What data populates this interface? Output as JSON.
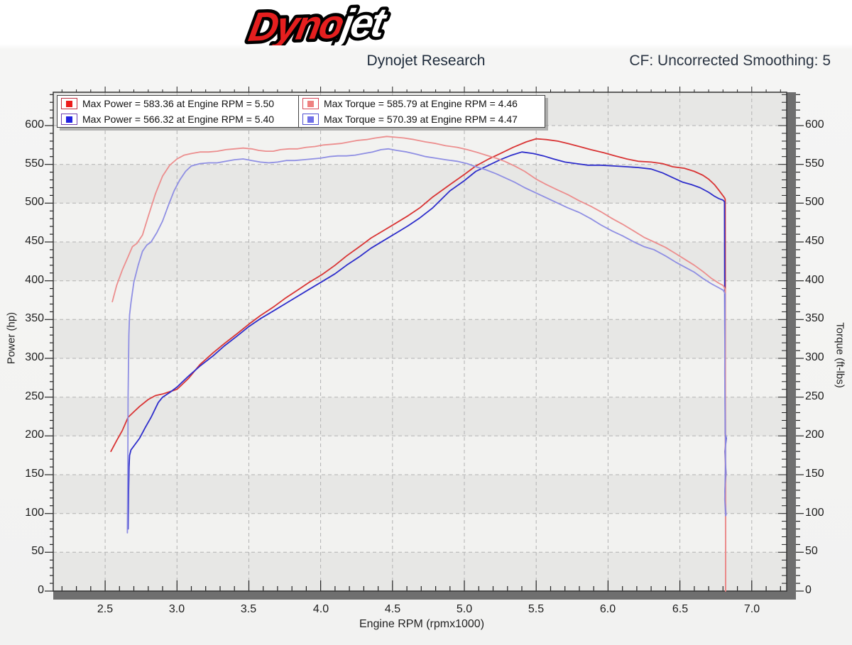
{
  "logo": {
    "dyno": "Dyno",
    "jet": "jet",
    "dyno_color": "#e51f1f",
    "jet_color": "#ffffff"
  },
  "header": {
    "title": "Dynojet Research",
    "cf_label": "CF: Uncorrected Smoothing: 5"
  },
  "legend": [
    {
      "label": "Max Power = 583.36 at Engine RPM = 5.50",
      "swatch": "#ed1c1c",
      "border": "#c03040"
    },
    {
      "label": "Max Power = 566.32 at Engine RPM = 5.40",
      "swatch": "#2222e0",
      "border": "#7040b0"
    },
    {
      "label": "Max Torque = 585.79 at Engine RPM = 4.46",
      "swatch": "#ef8080",
      "border": "#d84858"
    },
    {
      "label": "Max Torque = 570.39 at Engine RPM = 4.47",
      "swatch": "#7070e8",
      "border": "#5050d0"
    }
  ],
  "chart_data": {
    "type": "line",
    "xlabel": "Engine RPM (rpmx1000)",
    "ylabel_left": "Power (hp)",
    "ylabel_right": "Torque (ft-lbs)",
    "xlim": [
      2.139,
      7.243
    ],
    "ylim": [
      0,
      643
    ],
    "x_ticks": [
      "2.5",
      "3.0",
      "3.5",
      "4.0",
      "4.5",
      "5.0",
      "5.5",
      "6.0",
      "6.5",
      "7.0"
    ],
    "x_minor_step": 0.1,
    "y_ticks": [
      0,
      50,
      100,
      150,
      200,
      250,
      300,
      350,
      400,
      450,
      500,
      550,
      600
    ],
    "y_minor_step": 10,
    "grid": "dashed",
    "band_colors": [
      "#e7e7e5",
      "#f2f2f0"
    ],
    "grid_color": "#b2b2b2",
    "max_values": [
      {
        "series": "power-run1",
        "value": 583.36,
        "rpm": 5.5
      },
      {
        "series": "power-run2",
        "value": 566.32,
        "rpm": 5.4
      },
      {
        "series": "torque-run1",
        "value": 585.79,
        "rpm": 4.46
      },
      {
        "series": "torque-run2",
        "value": 570.39,
        "rpm": 4.47
      }
    ],
    "series": [
      {
        "name": "power-run1",
        "color": "#d93434",
        "points": [
          [
            2.54,
            180
          ],
          [
            2.58,
            194
          ],
          [
            2.62,
            207
          ],
          [
            2.66,
            224
          ],
          [
            2.7,
            231
          ],
          [
            2.74,
            238
          ],
          [
            2.8,
            247
          ],
          [
            2.85,
            252
          ],
          [
            2.9,
            254
          ],
          [
            2.95,
            257
          ],
          [
            3.0,
            260
          ],
          [
            3.08,
            274
          ],
          [
            3.16,
            292
          ],
          [
            3.25,
            307
          ],
          [
            3.33,
            319
          ],
          [
            3.42,
            332
          ],
          [
            3.5,
            344
          ],
          [
            3.58,
            355
          ],
          [
            3.67,
            366
          ],
          [
            3.75,
            377
          ],
          [
            3.84,
            388
          ],
          [
            3.92,
            398
          ],
          [
            4.01,
            408
          ],
          [
            4.1,
            420
          ],
          [
            4.18,
            432
          ],
          [
            4.27,
            444
          ],
          [
            4.35,
            455
          ],
          [
            4.44,
            465
          ],
          [
            4.53,
            475
          ],
          [
            4.61,
            484
          ],
          [
            4.69,
            494
          ],
          [
            4.78,
            508
          ],
          [
            4.9,
            524
          ],
          [
            5.0,
            537
          ],
          [
            5.08,
            548
          ],
          [
            5.17,
            557
          ],
          [
            5.25,
            564
          ],
          [
            5.34,
            572
          ],
          [
            5.43,
            579
          ],
          [
            5.5,
            583
          ],
          [
            5.57,
            582
          ],
          [
            5.65,
            580
          ],
          [
            5.72,
            577
          ],
          [
            5.8,
            573
          ],
          [
            5.88,
            569
          ],
          [
            5.97,
            565
          ],
          [
            6.05,
            561
          ],
          [
            6.13,
            557
          ],
          [
            6.21,
            554
          ],
          [
            6.3,
            553
          ],
          [
            6.38,
            551
          ],
          [
            6.45,
            547
          ],
          [
            6.53,
            545
          ],
          [
            6.6,
            541
          ],
          [
            6.66,
            536
          ],
          [
            6.7,
            531
          ],
          [
            6.74,
            524
          ],
          [
            6.77,
            517
          ],
          [
            6.79,
            512
          ],
          [
            6.81,
            507
          ],
          [
            6.815,
            505
          ],
          [
            6.818,
            0
          ]
        ]
      },
      {
        "name": "power-run2",
        "color": "#2d2dcb",
        "points": [
          [
            2.66,
            80
          ],
          [
            2.663,
            130
          ],
          [
            2.666,
            160
          ],
          [
            2.67,
            175
          ],
          [
            2.68,
            182
          ],
          [
            2.7,
            187
          ],
          [
            2.74,
            197
          ],
          [
            2.78,
            211
          ],
          [
            2.82,
            224
          ],
          [
            2.87,
            243
          ],
          [
            2.9,
            250
          ],
          [
            2.95,
            256
          ],
          [
            3.0,
            263
          ],
          [
            3.08,
            277
          ],
          [
            3.16,
            290
          ],
          [
            3.25,
            303
          ],
          [
            3.33,
            316
          ],
          [
            3.42,
            329
          ],
          [
            3.5,
            341
          ],
          [
            3.58,
            351
          ],
          [
            3.67,
            361
          ],
          [
            3.75,
            370
          ],
          [
            3.84,
            380
          ],
          [
            3.92,
            389
          ],
          [
            4.01,
            399
          ],
          [
            4.1,
            409
          ],
          [
            4.18,
            420
          ],
          [
            4.27,
            431
          ],
          [
            4.35,
            442
          ],
          [
            4.44,
            452
          ],
          [
            4.53,
            462
          ],
          [
            4.61,
            471
          ],
          [
            4.69,
            481
          ],
          [
            4.78,
            494
          ],
          [
            4.9,
            516
          ],
          [
            5.0,
            529
          ],
          [
            5.08,
            541
          ],
          [
            5.17,
            549
          ],
          [
            5.25,
            556
          ],
          [
            5.33,
            562
          ],
          [
            5.4,
            566
          ],
          [
            5.48,
            564
          ],
          [
            5.55,
            561
          ],
          [
            5.62,
            557
          ],
          [
            5.7,
            553
          ],
          [
            5.78,
            551
          ],
          [
            5.86,
            549
          ],
          [
            5.95,
            549
          ],
          [
            6.04,
            548
          ],
          [
            6.13,
            547
          ],
          [
            6.21,
            546
          ],
          [
            6.3,
            544
          ],
          [
            6.38,
            539
          ],
          [
            6.45,
            533
          ],
          [
            6.52,
            527
          ],
          [
            6.58,
            524
          ],
          [
            6.64,
            520
          ],
          [
            6.7,
            514
          ],
          [
            6.74,
            509
          ],
          [
            6.77,
            506
          ],
          [
            6.8,
            504
          ],
          [
            6.81,
            502
          ],
          [
            6.812,
            350
          ],
          [
            6.815,
            203
          ],
          [
            6.822,
            197
          ],
          [
            6.814,
            180
          ],
          [
            6.82,
            152
          ],
          [
            6.813,
            128
          ],
          [
            6.82,
            98
          ]
        ]
      },
      {
        "name": "torque-run1",
        "color": "#ec8e8e",
        "points": [
          [
            2.55,
            373
          ],
          [
            2.58,
            394
          ],
          [
            2.62,
            414
          ],
          [
            2.66,
            431
          ],
          [
            2.69,
            444
          ],
          [
            2.72,
            448
          ],
          [
            2.76,
            459
          ],
          [
            2.8,
            483
          ],
          [
            2.85,
            512
          ],
          [
            2.9,
            535
          ],
          [
            2.95,
            549
          ],
          [
            3.0,
            557
          ],
          [
            3.05,
            562
          ],
          [
            3.1,
            564
          ],
          [
            3.16,
            566
          ],
          [
            3.22,
            566
          ],
          [
            3.28,
            567
          ],
          [
            3.34,
            569
          ],
          [
            3.4,
            570
          ],
          [
            3.46,
            571
          ],
          [
            3.52,
            570
          ],
          [
            3.57,
            568
          ],
          [
            3.62,
            567
          ],
          [
            3.67,
            567
          ],
          [
            3.72,
            569
          ],
          [
            3.78,
            570
          ],
          [
            3.84,
            570
          ],
          [
            3.9,
            572
          ],
          [
            3.96,
            573
          ],
          [
            4.02,
            575
          ],
          [
            4.08,
            576
          ],
          [
            4.14,
            577
          ],
          [
            4.2,
            579
          ],
          [
            4.26,
            581
          ],
          [
            4.32,
            582
          ],
          [
            4.38,
            584
          ],
          [
            4.46,
            586
          ],
          [
            4.52,
            585
          ],
          [
            4.58,
            584
          ],
          [
            4.65,
            582
          ],
          [
            4.73,
            579
          ],
          [
            4.8,
            577
          ],
          [
            4.87,
            574
          ],
          [
            4.95,
            572
          ],
          [
            5.02,
            569
          ],
          [
            5.08,
            566
          ],
          [
            5.15,
            562
          ],
          [
            5.22,
            558
          ],
          [
            5.28,
            554
          ],
          [
            5.35,
            548
          ],
          [
            5.42,
            541
          ],
          [
            5.5,
            531
          ],
          [
            5.57,
            524
          ],
          [
            5.65,
            517
          ],
          [
            5.72,
            511
          ],
          [
            5.8,
            503
          ],
          [
            5.88,
            496
          ],
          [
            5.95,
            489
          ],
          [
            6.03,
            480
          ],
          [
            6.1,
            473
          ],
          [
            6.18,
            464
          ],
          [
            6.25,
            456
          ],
          [
            6.32,
            450
          ],
          [
            6.4,
            443
          ],
          [
            6.47,
            435
          ],
          [
            6.54,
            427
          ],
          [
            6.6,
            420
          ],
          [
            6.66,
            412
          ],
          [
            6.72,
            403
          ],
          [
            6.77,
            397
          ],
          [
            6.8,
            394
          ],
          [
            6.81,
            391
          ],
          [
            6.815,
            389
          ],
          [
            6.818,
            0
          ]
        ]
      },
      {
        "name": "torque-run2",
        "color": "#8f8fe3",
        "points": [
          [
            2.655,
            75
          ],
          [
            2.658,
            150
          ],
          [
            2.66,
            250
          ],
          [
            2.665,
            330
          ],
          [
            2.67,
            356
          ],
          [
            2.68,
            372
          ],
          [
            2.7,
            398
          ],
          [
            2.73,
            420
          ],
          [
            2.76,
            438
          ],
          [
            2.79,
            446
          ],
          [
            2.82,
            450
          ],
          [
            2.86,
            462
          ],
          [
            2.9,
            477
          ],
          [
            2.94,
            497
          ],
          [
            2.98,
            516
          ],
          [
            3.02,
            530
          ],
          [
            3.06,
            541
          ],
          [
            3.1,
            548
          ],
          [
            3.16,
            551
          ],
          [
            3.22,
            552
          ],
          [
            3.28,
            552
          ],
          [
            3.34,
            554
          ],
          [
            3.4,
            556
          ],
          [
            3.46,
            557
          ],
          [
            3.52,
            555
          ],
          [
            3.58,
            553
          ],
          [
            3.64,
            552
          ],
          [
            3.7,
            553
          ],
          [
            3.76,
            555
          ],
          [
            3.82,
            555
          ],
          [
            3.88,
            556
          ],
          [
            3.94,
            557
          ],
          [
            4.0,
            558
          ],
          [
            4.06,
            560
          ],
          [
            4.12,
            561
          ],
          [
            4.18,
            561
          ],
          [
            4.24,
            562
          ],
          [
            4.3,
            564
          ],
          [
            4.36,
            566
          ],
          [
            4.42,
            569
          ],
          [
            4.47,
            570
          ],
          [
            4.53,
            568
          ],
          [
            4.6,
            566
          ],
          [
            4.67,
            563
          ],
          [
            4.73,
            560
          ],
          [
            4.8,
            558
          ],
          [
            4.87,
            556
          ],
          [
            4.95,
            554
          ],
          [
            5.02,
            551
          ],
          [
            5.08,
            547
          ],
          [
            5.15,
            543
          ],
          [
            5.22,
            538
          ],
          [
            5.28,
            533
          ],
          [
            5.35,
            527
          ],
          [
            5.42,
            520
          ],
          [
            5.5,
            513
          ],
          [
            5.57,
            507
          ],
          [
            5.65,
            500
          ],
          [
            5.72,
            494
          ],
          [
            5.8,
            488
          ],
          [
            5.88,
            480
          ],
          [
            5.95,
            472
          ],
          [
            6.03,
            464
          ],
          [
            6.1,
            458
          ],
          [
            6.18,
            450
          ],
          [
            6.25,
            444
          ],
          [
            6.32,
            440
          ],
          [
            6.4,
            432
          ],
          [
            6.47,
            424
          ],
          [
            6.54,
            417
          ],
          [
            6.6,
            411
          ],
          [
            6.66,
            403
          ],
          [
            6.72,
            396
          ],
          [
            6.77,
            391
          ],
          [
            6.8,
            388
          ],
          [
            6.81,
            385
          ],
          [
            6.814,
            383
          ],
          [
            6.812,
            280
          ],
          [
            6.818,
            175
          ],
          [
            6.812,
            118
          ],
          [
            6.818,
            97
          ]
        ]
      }
    ]
  }
}
